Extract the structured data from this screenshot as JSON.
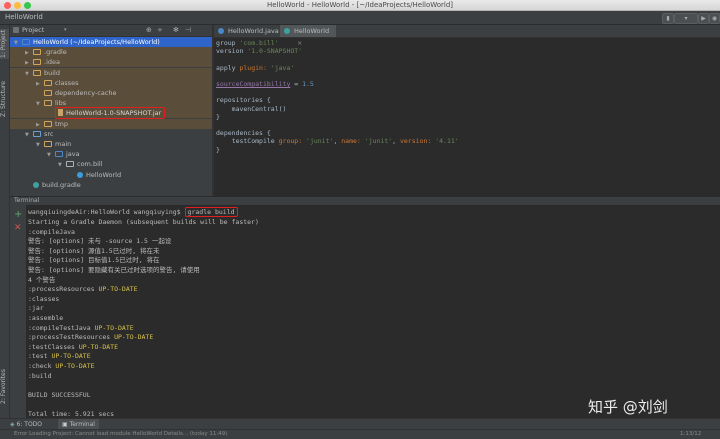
{
  "window": {
    "title": "HelloWorld - HelloWorld - [~/IdeaProjects/HelloWorld]"
  },
  "navbar": {
    "crumb": "HelloWorld"
  },
  "left_stripe": {
    "tabs": [
      "1: Project",
      "Z: Structure",
      "2: Favorites"
    ]
  },
  "project_panel": {
    "header": "Project",
    "tree": [
      {
        "label": "HelloWorld (~/IdeaProjects/HelloWorld)",
        "depth": 0,
        "arrow": "▼",
        "kind": "module",
        "selected": true
      },
      {
        "label": ".gradle",
        "depth": 1,
        "arrow": "▶",
        "kind": "folder"
      },
      {
        "label": ".idea",
        "depth": 1,
        "arrow": "▶",
        "kind": "folder"
      },
      {
        "label": "build",
        "depth": 1,
        "arrow": "▼",
        "kind": "folder"
      },
      {
        "label": "classes",
        "depth": 2,
        "arrow": "▶",
        "kind": "folder"
      },
      {
        "label": "dependency-cache",
        "depth": 2,
        "arrow": "",
        "kind": "folder"
      },
      {
        "label": "libs",
        "depth": 2,
        "arrow": "▼",
        "kind": "folder"
      },
      {
        "label": "HelloWorld-1.0-SNAPSHOT.jar",
        "depth": 3,
        "arrow": "",
        "kind": "jar",
        "highlight": true
      },
      {
        "label": "tmp",
        "depth": 2,
        "arrow": "▶",
        "kind": "folder"
      },
      {
        "label": "src",
        "depth": 1,
        "arrow": "▼",
        "kind": "src"
      },
      {
        "label": "main",
        "depth": 2,
        "arrow": "▼",
        "kind": "folder"
      },
      {
        "label": "java",
        "depth": 3,
        "arrow": "▼",
        "kind": "srcfolder"
      },
      {
        "label": "com.bill",
        "depth": 4,
        "arrow": "▼",
        "kind": "package"
      },
      {
        "label": "HelloWorld",
        "depth": 5,
        "arrow": "",
        "kind": "class"
      },
      {
        "label": "build.gradle",
        "depth": 1,
        "arrow": "",
        "kind": "gradle"
      }
    ]
  },
  "editor": {
    "tabs": [
      {
        "label": "HelloWorld.java",
        "active": false
      },
      {
        "label": "HelloWorld",
        "active": true
      }
    ],
    "code": [
      [
        {
          "t": "group ",
          "c": "#a9b7c6"
        },
        {
          "t": "'com.bill'",
          "c": "#6a8759"
        }
      ],
      [
        {
          "t": "version ",
          "c": "#a9b7c6"
        },
        {
          "t": "'1.0-SNAPSHOT'",
          "c": "#6a8759"
        }
      ],
      [],
      [
        {
          "t": "apply ",
          "c": "#a9b7c6"
        },
        {
          "t": "plugin: ",
          "c": "#cc7832"
        },
        {
          "t": "'java'",
          "c": "#6a8759"
        }
      ],
      [],
      [
        {
          "t": "sourceCompatibility",
          "c": "#9876aa",
          "u": true
        },
        {
          "t": " = ",
          "c": "#a9b7c6"
        },
        {
          "t": "1.5",
          "c": "#6897bb"
        }
      ],
      [],
      [
        {
          "t": "repositories {",
          "c": "#a9b7c6"
        }
      ],
      [
        {
          "t": "    mavenCentral()",
          "c": "#a9b7c6"
        }
      ],
      [
        {
          "t": "}",
          "c": "#a9b7c6"
        }
      ],
      [],
      [
        {
          "t": "dependencies {",
          "c": "#a9b7c6"
        }
      ],
      [
        {
          "t": "    testCompile ",
          "c": "#a9b7c6"
        },
        {
          "t": "group: ",
          "c": "#cc7832"
        },
        {
          "t": "'junit'",
          "c": "#6a8759"
        },
        {
          "t": ", ",
          "c": "#a9b7c6"
        },
        {
          "t": "name: ",
          "c": "#cc7832"
        },
        {
          "t": "'junit'",
          "c": "#6a8759"
        },
        {
          "t": ", ",
          "c": "#a9b7c6"
        },
        {
          "t": "version: ",
          "c": "#cc7832"
        },
        {
          "t": "'4.11'",
          "c": "#6a8759"
        }
      ],
      [
        {
          "t": "}",
          "c": "#a9b7c6"
        }
      ]
    ]
  },
  "terminal": {
    "header": "Terminal",
    "prompt": "wangqiuingdeAir:HelloWorld wangqiuying$ ",
    "command": "gradle build",
    "lines": [
      [
        {
          "t": "Starting a Gradle Daemon (subsequent builds will be faster)",
          "c": "#bbbbbb"
        }
      ],
      [
        {
          "t": ":compileJava",
          "c": "#bbbbbb"
        }
      ],
      [
        {
          "t": "警告: [options] 未与 -source 1.5 一起设",
          "c": "#bbbbbb"
        }
      ],
      [
        {
          "t": "警告: [options] 源值1.5已过时, 将在未",
          "c": "#bbbbbb"
        }
      ],
      [
        {
          "t": "警告: [options] 目标值1.5已过时, 将在",
          "c": "#bbbbbb"
        }
      ],
      [
        {
          "t": "警告: [options] 要隐藏有关已过时选项的警告, 请使用",
          "c": "#bbbbbb"
        }
      ],
      [
        {
          "t": "4 个警告",
          "c": "#bbbbbb"
        }
      ],
      [
        {
          "t": ":processResources ",
          "c": "#bbbbbb"
        },
        {
          "t": "UP-TO-DATE",
          "c": "#d8c34b"
        }
      ],
      [
        {
          "t": ":classes",
          "c": "#bbbbbb"
        }
      ],
      [
        {
          "t": ":jar",
          "c": "#bbbbbb"
        }
      ],
      [
        {
          "t": ":assemble",
          "c": "#bbbbbb"
        }
      ],
      [
        {
          "t": ":compileTestJava ",
          "c": "#bbbbbb"
        },
        {
          "t": "UP-TO-DATE",
          "c": "#d8c34b"
        }
      ],
      [
        {
          "t": ":processTestResources ",
          "c": "#bbbbbb"
        },
        {
          "t": "UP-TO-DATE",
          "c": "#d8c34b"
        }
      ],
      [
        {
          "t": ":testClasses ",
          "c": "#bbbbbb"
        },
        {
          "t": "UP-TO-DATE",
          "c": "#d8c34b"
        }
      ],
      [
        {
          "t": ":test ",
          "c": "#bbbbbb"
        },
        {
          "t": "UP-TO-DATE",
          "c": "#d8c34b"
        }
      ],
      [
        {
          "t": ":check ",
          "c": "#bbbbbb"
        },
        {
          "t": "UP-TO-DATE",
          "c": "#d8c34b"
        }
      ],
      [
        {
          "t": ":build",
          "c": "#bbbbbb"
        }
      ],
      [],
      [
        {
          "t": "BUILD SUCCESSFUL",
          "c": "#bbbbbb"
        }
      ],
      [],
      [
        {
          "t": "Total time: 5.921 secs",
          "c": "#bbbbbb"
        }
      ]
    ]
  },
  "bottom_tabs": [
    {
      "label": "6: TODO",
      "icon": "todo-icon"
    },
    {
      "label": "Terminal",
      "icon": "terminal-icon",
      "active": true
    }
  ],
  "status_bar": {
    "message": "Error Loading Project: Cannot load module HelloWorld Details... (today 11:49)",
    "position": "1:13/12"
  },
  "watermark": "知乎 @刘剑",
  "colors": {
    "accent_blue": "#4a88c7",
    "highlight_red": "#e02020",
    "excluded_folder_bg": "#5a4d3a",
    "string_green": "#6a8759",
    "keyword_orange": "#cc7832",
    "uptodate_yellow": "#d8c34b"
  }
}
